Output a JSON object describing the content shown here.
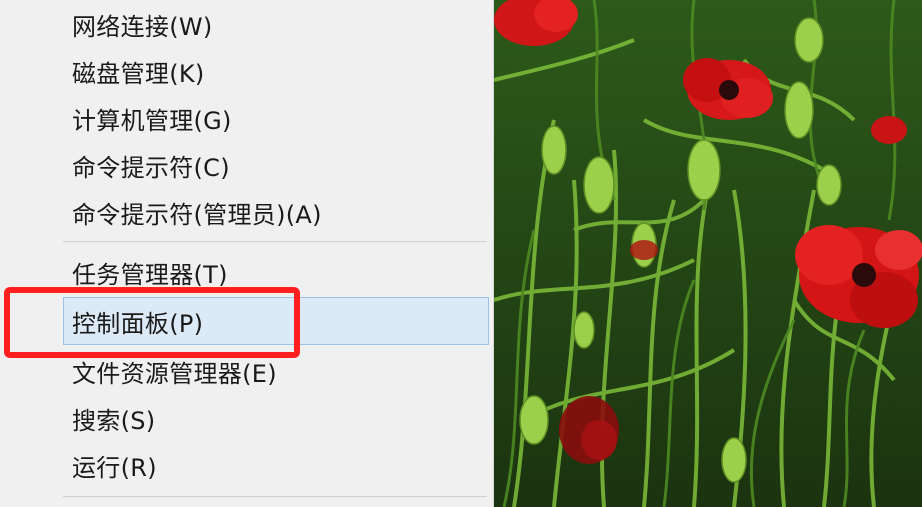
{
  "menu": {
    "items": [
      {
        "label": "网络连接(W)"
      },
      {
        "label": "磁盘管理(K)"
      },
      {
        "label": "计算机管理(G)"
      },
      {
        "label": "命令提示符(C)"
      },
      {
        "label": "命令提示符(管理员)(A)"
      },
      {
        "label": "任务管理器(T)"
      },
      {
        "label": "控制面板(P)"
      },
      {
        "label": "文件资源管理器(E)"
      },
      {
        "label": "搜索(S)"
      },
      {
        "label": "运行(R)"
      }
    ],
    "highlighted_item": "控制面板(P)"
  },
  "colors": {
    "menu_background": "#f0f0f0",
    "hover_background": "#dce9f6",
    "hover_border": "#9cc1e8",
    "annotation_box": "#ff1f1f"
  },
  "wallpaper": {
    "description_icon": "poppy-flowers-image"
  }
}
